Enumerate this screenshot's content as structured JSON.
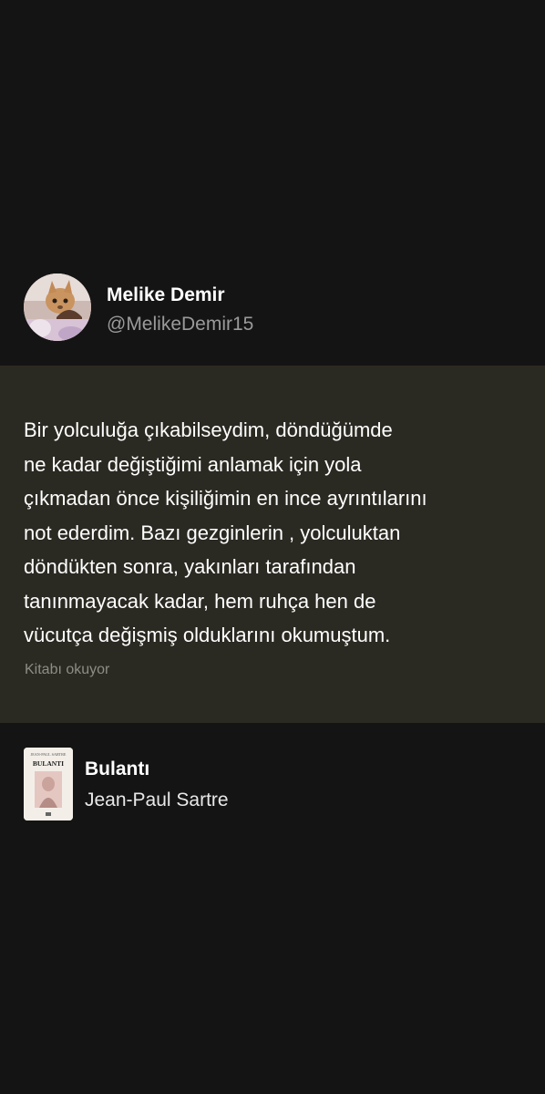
{
  "user": {
    "name": "Melike Demir",
    "handle": "@MelikeDemir15",
    "avatar_icon": "profile-photo"
  },
  "quote": {
    "lines": [
      "Bir yolculuğa çıkabilseydim, döndüğümde",
      "ne kadar değiştiğimi anlamak için yola",
      "çıkmadan önce kişiliğimin en ince ayrıntılarını",
      "not ederdim. Bazı gezginlerin , yolculuktan",
      "döndükten sonra, yakınları tarafından",
      "tanınmayacak kadar, hem ruhça hen de",
      "vücutça değişmiş olduklarını okumuştum."
    ],
    "status": "Kitabı okuyor",
    "background_color": "#2b2a22"
  },
  "book": {
    "title": "Bulantı",
    "author": "Jean-Paul Sartre",
    "cover": {
      "author_caption": "JEAN-PAUL SARTRE",
      "title_caption": "BULANTI"
    }
  },
  "colors": {
    "page_background": "#141414",
    "handle_text": "#9a9a9a",
    "status_text": "#8e8d85"
  }
}
